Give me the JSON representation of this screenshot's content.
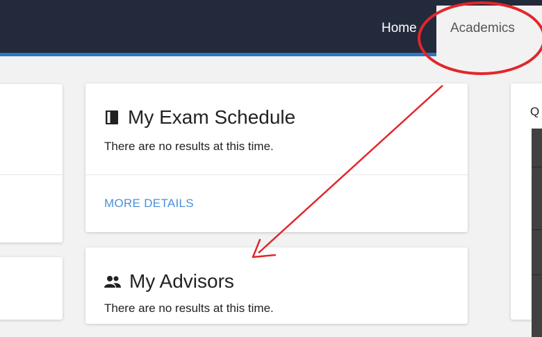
{
  "nav": {
    "home_label": "Home",
    "academics_label": "Academics"
  },
  "exam_card": {
    "title": "My Exam Schedule",
    "body": "There are no results at this time.",
    "more_label": "MORE DETAILS"
  },
  "advisors_card": {
    "title": "My Advisors",
    "body": "There are no results at this time."
  },
  "right_card": {
    "label": "Q"
  },
  "icons": {
    "exam": "book-icon",
    "advisors": "people-icon"
  },
  "colors": {
    "topbar": "#232a3b",
    "accent": "#2b78c5",
    "link": "#4a90d9",
    "annotation": "#e2262b"
  }
}
